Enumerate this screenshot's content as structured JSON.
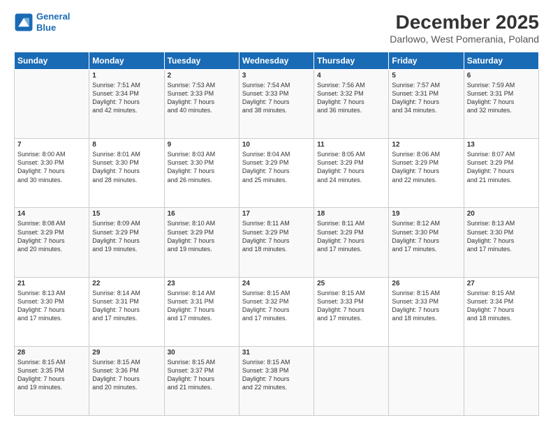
{
  "header": {
    "logo_line1": "General",
    "logo_line2": "Blue",
    "title": "December 2025",
    "subtitle": "Darlowo, West Pomerania, Poland"
  },
  "days": [
    "Sunday",
    "Monday",
    "Tuesday",
    "Wednesday",
    "Thursday",
    "Friday",
    "Saturday"
  ],
  "weeks": [
    [
      {
        "date": "",
        "info": ""
      },
      {
        "date": "1",
        "info": "Sunrise: 7:51 AM\nSunset: 3:34 PM\nDaylight: 7 hours\nand 42 minutes."
      },
      {
        "date": "2",
        "info": "Sunrise: 7:53 AM\nSunset: 3:33 PM\nDaylight: 7 hours\nand 40 minutes."
      },
      {
        "date": "3",
        "info": "Sunrise: 7:54 AM\nSunset: 3:33 PM\nDaylight: 7 hours\nand 38 minutes."
      },
      {
        "date": "4",
        "info": "Sunrise: 7:56 AM\nSunset: 3:32 PM\nDaylight: 7 hours\nand 36 minutes."
      },
      {
        "date": "5",
        "info": "Sunrise: 7:57 AM\nSunset: 3:31 PM\nDaylight: 7 hours\nand 34 minutes."
      },
      {
        "date": "6",
        "info": "Sunrise: 7:59 AM\nSunset: 3:31 PM\nDaylight: 7 hours\nand 32 minutes."
      }
    ],
    [
      {
        "date": "7",
        "info": "Sunrise: 8:00 AM\nSunset: 3:30 PM\nDaylight: 7 hours\nand 30 minutes."
      },
      {
        "date": "8",
        "info": "Sunrise: 8:01 AM\nSunset: 3:30 PM\nDaylight: 7 hours\nand 28 minutes."
      },
      {
        "date": "9",
        "info": "Sunrise: 8:03 AM\nSunset: 3:30 PM\nDaylight: 7 hours\nand 26 minutes."
      },
      {
        "date": "10",
        "info": "Sunrise: 8:04 AM\nSunset: 3:29 PM\nDaylight: 7 hours\nand 25 minutes."
      },
      {
        "date": "11",
        "info": "Sunrise: 8:05 AM\nSunset: 3:29 PM\nDaylight: 7 hours\nand 24 minutes."
      },
      {
        "date": "12",
        "info": "Sunrise: 8:06 AM\nSunset: 3:29 PM\nDaylight: 7 hours\nand 22 minutes."
      },
      {
        "date": "13",
        "info": "Sunrise: 8:07 AM\nSunset: 3:29 PM\nDaylight: 7 hours\nand 21 minutes."
      }
    ],
    [
      {
        "date": "14",
        "info": "Sunrise: 8:08 AM\nSunset: 3:29 PM\nDaylight: 7 hours\nand 20 minutes."
      },
      {
        "date": "15",
        "info": "Sunrise: 8:09 AM\nSunset: 3:29 PM\nDaylight: 7 hours\nand 19 minutes."
      },
      {
        "date": "16",
        "info": "Sunrise: 8:10 AM\nSunset: 3:29 PM\nDaylight: 7 hours\nand 19 minutes."
      },
      {
        "date": "17",
        "info": "Sunrise: 8:11 AM\nSunset: 3:29 PM\nDaylight: 7 hours\nand 18 minutes."
      },
      {
        "date": "18",
        "info": "Sunrise: 8:11 AM\nSunset: 3:29 PM\nDaylight: 7 hours\nand 17 minutes."
      },
      {
        "date": "19",
        "info": "Sunrise: 8:12 AM\nSunset: 3:30 PM\nDaylight: 7 hours\nand 17 minutes."
      },
      {
        "date": "20",
        "info": "Sunrise: 8:13 AM\nSunset: 3:30 PM\nDaylight: 7 hours\nand 17 minutes."
      }
    ],
    [
      {
        "date": "21",
        "info": "Sunrise: 8:13 AM\nSunset: 3:30 PM\nDaylight: 7 hours\nand 17 minutes."
      },
      {
        "date": "22",
        "info": "Sunrise: 8:14 AM\nSunset: 3:31 PM\nDaylight: 7 hours\nand 17 minutes."
      },
      {
        "date": "23",
        "info": "Sunrise: 8:14 AM\nSunset: 3:31 PM\nDaylight: 7 hours\nand 17 minutes."
      },
      {
        "date": "24",
        "info": "Sunrise: 8:15 AM\nSunset: 3:32 PM\nDaylight: 7 hours\nand 17 minutes."
      },
      {
        "date": "25",
        "info": "Sunrise: 8:15 AM\nSunset: 3:33 PM\nDaylight: 7 hours\nand 17 minutes."
      },
      {
        "date": "26",
        "info": "Sunrise: 8:15 AM\nSunset: 3:33 PM\nDaylight: 7 hours\nand 18 minutes."
      },
      {
        "date": "27",
        "info": "Sunrise: 8:15 AM\nSunset: 3:34 PM\nDaylight: 7 hours\nand 18 minutes."
      }
    ],
    [
      {
        "date": "28",
        "info": "Sunrise: 8:15 AM\nSunset: 3:35 PM\nDaylight: 7 hours\nand 19 minutes."
      },
      {
        "date": "29",
        "info": "Sunrise: 8:15 AM\nSunset: 3:36 PM\nDaylight: 7 hours\nand 20 minutes."
      },
      {
        "date": "30",
        "info": "Sunrise: 8:15 AM\nSunset: 3:37 PM\nDaylight: 7 hours\nand 21 minutes."
      },
      {
        "date": "31",
        "info": "Sunrise: 8:15 AM\nSunset: 3:38 PM\nDaylight: 7 hours\nand 22 minutes."
      },
      {
        "date": "",
        "info": ""
      },
      {
        "date": "",
        "info": ""
      },
      {
        "date": "",
        "info": ""
      }
    ]
  ]
}
